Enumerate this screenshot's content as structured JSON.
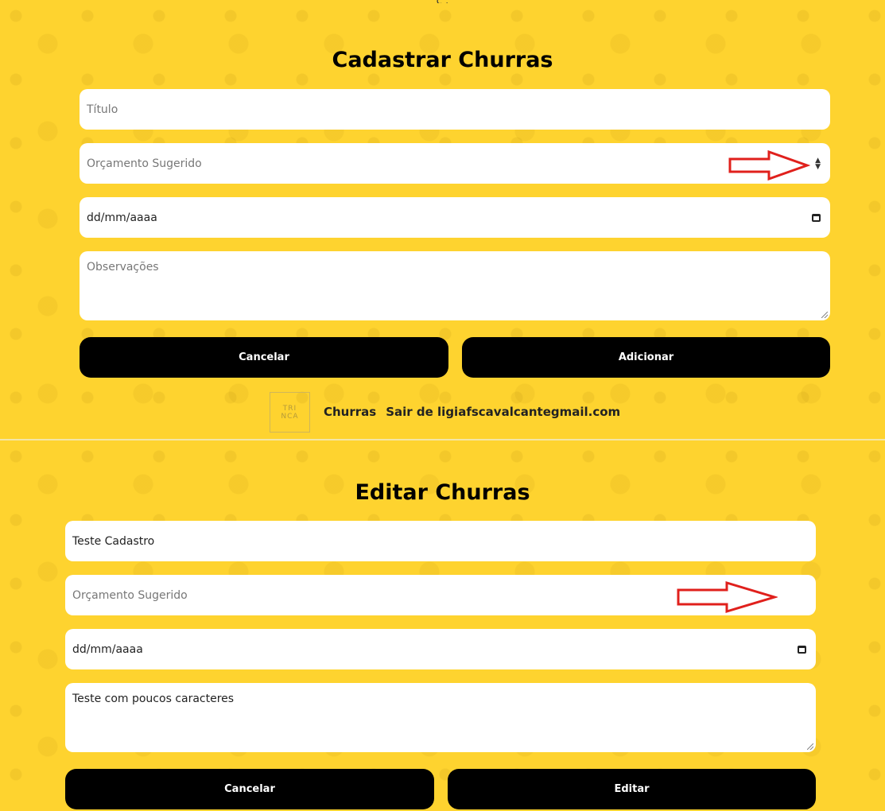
{
  "top_cut_text": "ç ,",
  "cadastrar": {
    "title": "Cadastrar Churras",
    "titulo_placeholder": "Título",
    "orcamento_placeholder": "Orçamento Sugerido",
    "data_placeholder": "dd/mm/aaaa",
    "observacoes_placeholder": "Observações",
    "cancel_label": "Cancelar",
    "submit_label": "Adicionar"
  },
  "footer": {
    "logo_text_line1": "TRI",
    "logo_text_line2": "NCA",
    "nav_churras": "Churras",
    "nav_logout": "Sair de ligiafscavalcantegmail.com"
  },
  "editar": {
    "title": "Editar Churras",
    "titulo_value": "Teste Cadastro",
    "orcamento_placeholder": "Orçamento Sugerido",
    "data_placeholder": "dd/mm/aaaa",
    "observacoes_value": "Teste com poucos caracteres",
    "cancel_label": "Cancelar",
    "submit_label": "Editar"
  },
  "colors": {
    "background": "#fed32f",
    "button": "#000000",
    "annotation_arrow": "#e0201c"
  },
  "icons": [
    "calendar-icon",
    "number-spinner-icon",
    "resize-handle-icon",
    "arrow-annotation-icon"
  ]
}
